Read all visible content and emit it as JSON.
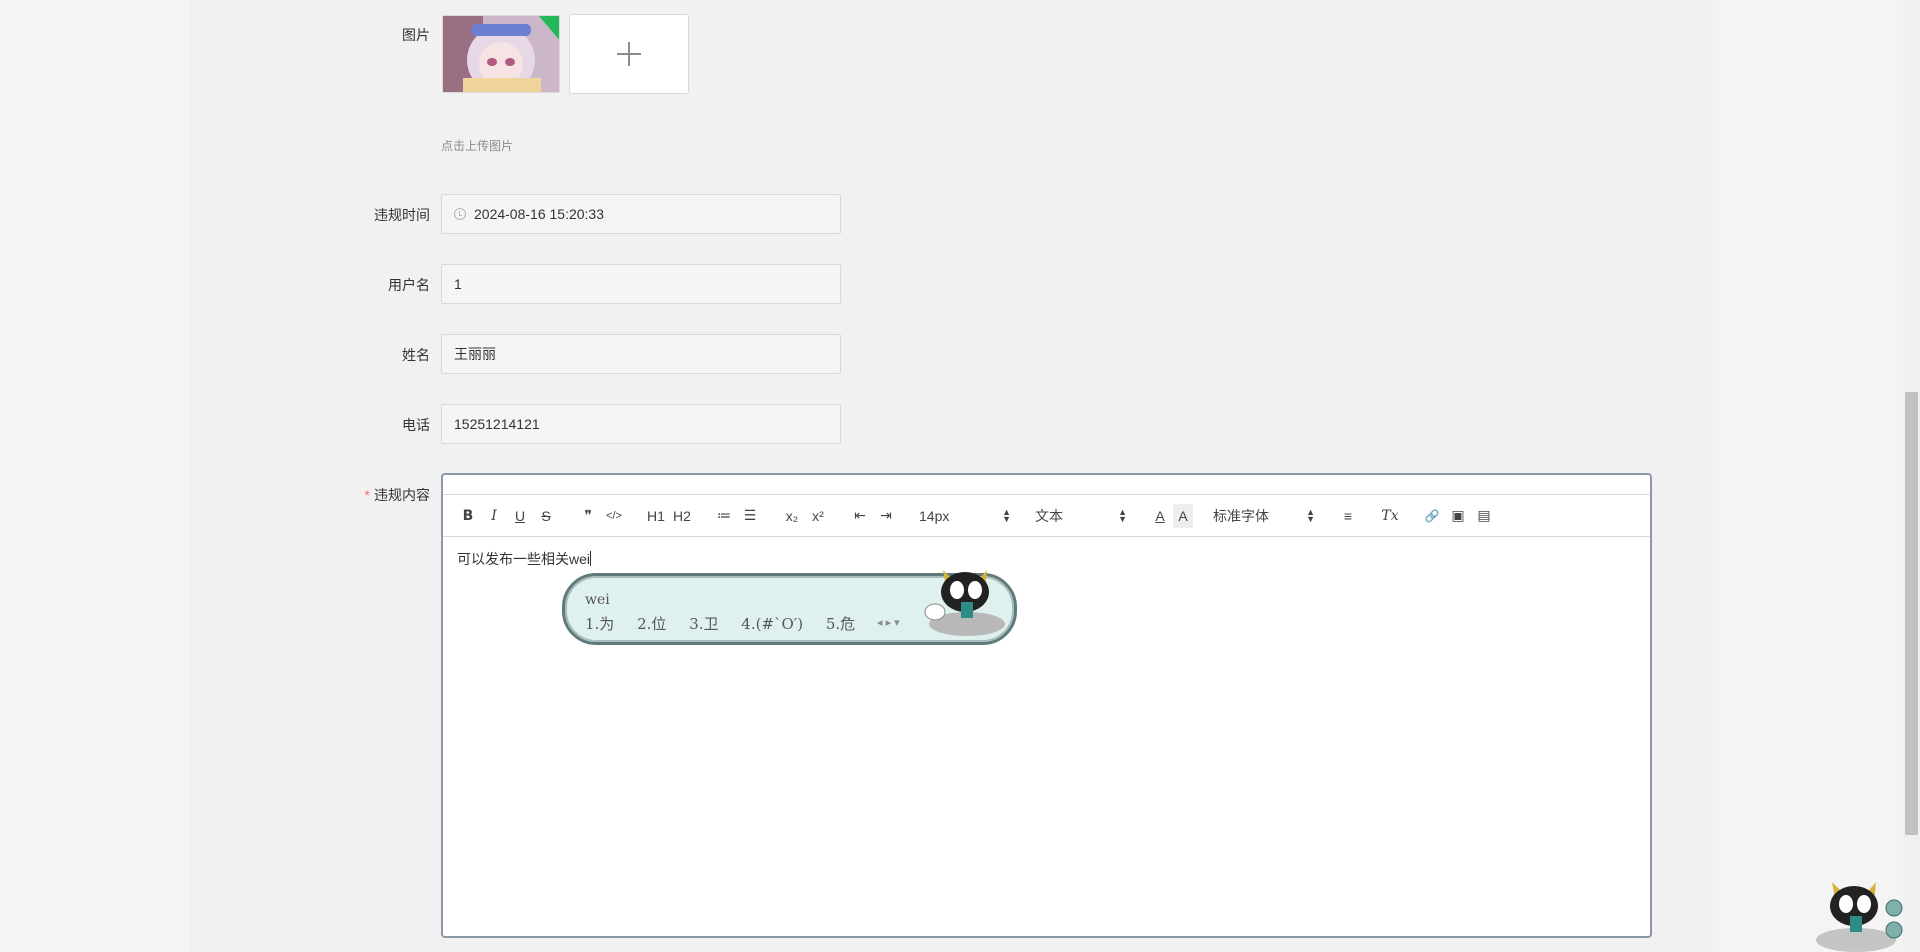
{
  "form": {
    "image_label": "图片",
    "upload_hint": "点击上传图片",
    "time_label": "违规时间",
    "time_value": "2024-08-16 15:20:33",
    "username_label": "用户名",
    "username_value": "1",
    "name_label": "姓名",
    "name_value": "王丽丽",
    "phone_label": "电话",
    "phone_value": "15251214121",
    "content_label": "违规内容",
    "required_mark": "*"
  },
  "editor": {
    "toolbar": {
      "bold": "B",
      "italic": "I",
      "underline": "U",
      "strike": "S",
      "quote": "❞",
      "code": "</>",
      "h1": "H1",
      "h2": "H2",
      "ordered_list": "≔",
      "bullet_list": "☰",
      "subscript": "x₂",
      "superscript": "x²",
      "outdent": "⇤",
      "indent": "⇥",
      "size": "14px",
      "format": "文本",
      "color": "A",
      "background": "A",
      "font": "标准字体",
      "align": "≡",
      "clean": "Tx",
      "link": "🔗",
      "image": "▣",
      "video": "▤"
    },
    "content": "可以发布一些相关wei"
  },
  "ime": {
    "input": "wei",
    "candidates": [
      "1.为",
      "2.位",
      "3.卫",
      "4.(#`O′)",
      "5.危"
    ]
  },
  "colors": {
    "required": "#f56c6c",
    "editor_border": "#8a98a8",
    "ime_bg": "#dff1ef"
  }
}
